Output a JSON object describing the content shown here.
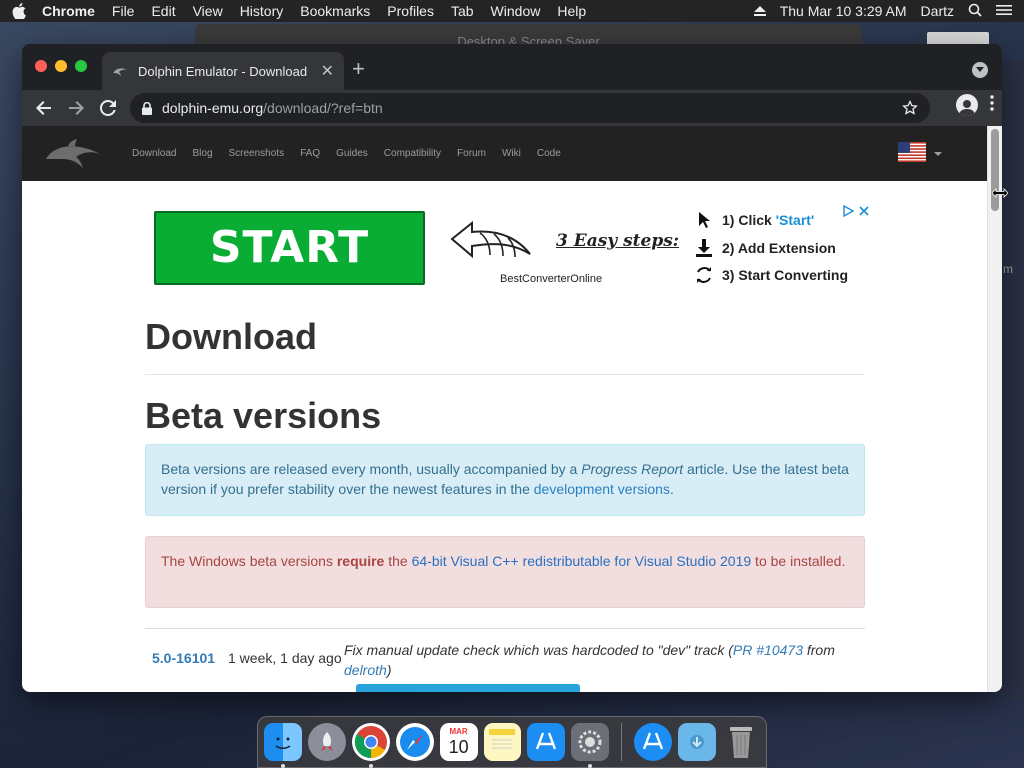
{
  "menubar": {
    "app": "Chrome",
    "items": [
      "File",
      "Edit",
      "View",
      "History",
      "Bookmarks",
      "Profiles",
      "Tab",
      "Window",
      "Help"
    ],
    "clock": "Thu Mar 10  3:29 AM",
    "user": "Dartz"
  },
  "background_window": {
    "title": "Desktop & Screen Saver"
  },
  "browser": {
    "tab_title": "Dolphin Emulator - Download",
    "url_host": "dolphin-emu.org",
    "url_path": "/download/?ref=btn"
  },
  "site": {
    "nav": [
      "Download",
      "Blog",
      "Screenshots",
      "FAQ",
      "Guides",
      "Compatibility",
      "Forum",
      "Wiki",
      "Code"
    ]
  },
  "ad": {
    "start_label": "START",
    "site_label": "BestConverterOnline",
    "steps_title": "3 Easy steps:",
    "step1_prefix": "1) Click ",
    "step1_highlight": "'Start'",
    "step2": "2) Add Extension",
    "step3": "3) Start Converting"
  },
  "page": {
    "title": "Download",
    "section_title": "Beta versions",
    "info_text_1": "Beta versions are released every month, usually accompanied by a ",
    "info_italic": "Progress Report",
    "info_text_2": " article. Use the latest beta version if you prefer stability over the newest features in the ",
    "info_link": "development versions",
    "info_text_3": ".",
    "danger_text_1": "The Windows beta versions ",
    "danger_bold": "require",
    "danger_text_2": " the ",
    "danger_link": "64-bit Visual C++ redistributable for Visual Studio 2019",
    "danger_text_3": " to be installed."
  },
  "release": {
    "version": "5.0-16101",
    "age": "1 week, 1 day ago",
    "desc_1": "Fix manual update check which was hardcoded to \"dev\" track (",
    "desc_link": "PR #10473",
    "desc_2": " from ",
    "desc_author": "delroth",
    "desc_3": ")"
  },
  "dock": {
    "icons": [
      "finder-icon",
      "launchpad-icon",
      "chrome-icon",
      "safari-icon",
      "calendar-icon",
      "notes-icon",
      "app-store-icon",
      "system-preferences-icon",
      "app-store-downloads-icon",
      "downloads-folder-icon",
      "trash-icon"
    ],
    "calendar_month": "MAR",
    "calendar_day": "10"
  },
  "colors": {
    "start_green": "#0aad33",
    "link_blue": "#337ab7",
    "alert_info_bg": "#d9edf7",
    "alert_danger_bg": "#f2dede",
    "site_nav_bg": "#222222"
  }
}
